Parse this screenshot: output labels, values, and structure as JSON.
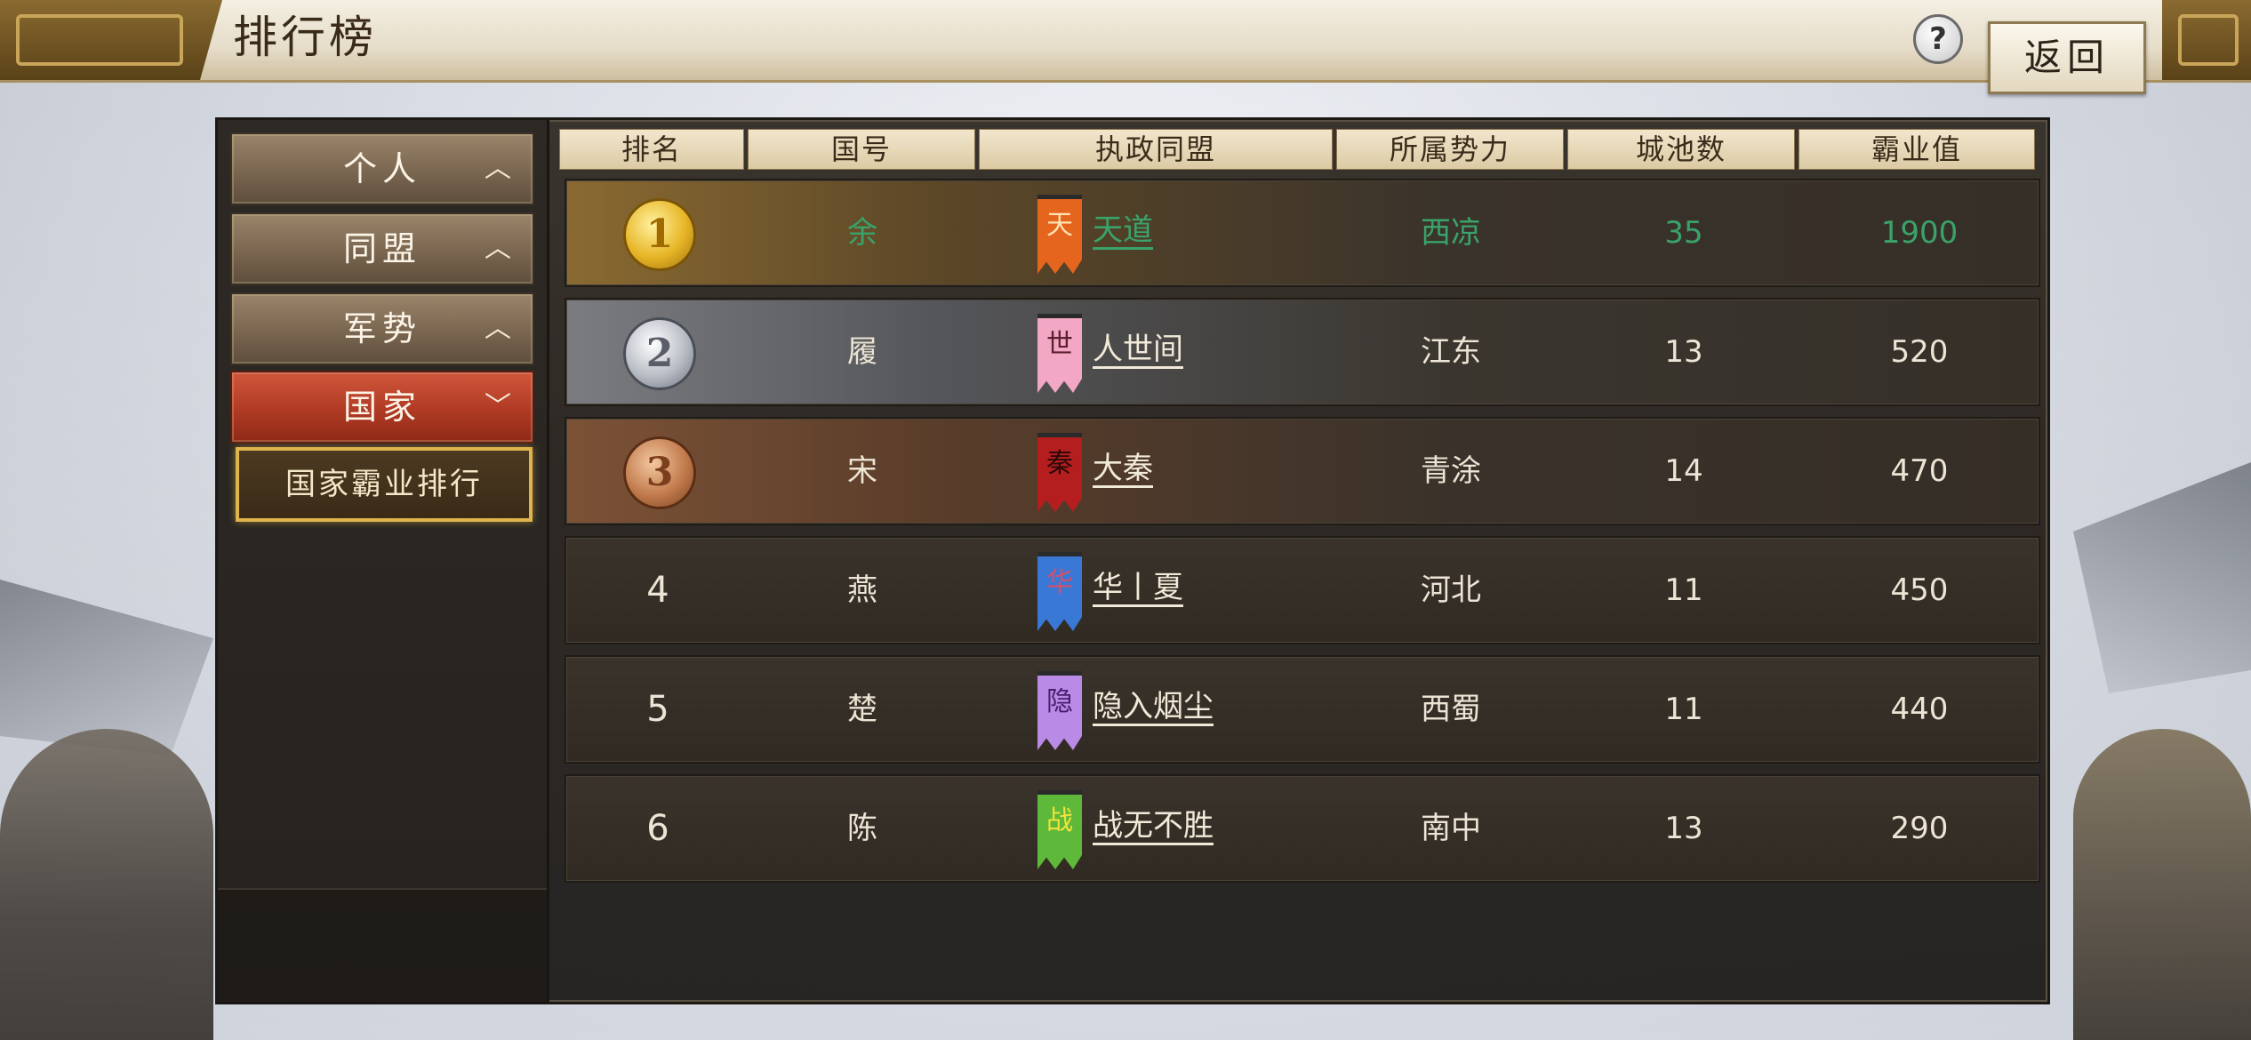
{
  "header": {
    "title": "排行榜",
    "help_label": "?",
    "back_label": "返回"
  },
  "sidebar": {
    "items": [
      {
        "label": "个人",
        "chevron": "︿"
      },
      {
        "label": "同盟",
        "chevron": "︿"
      },
      {
        "label": "军势",
        "chevron": "︿"
      },
      {
        "label": "国家",
        "chevron": "﹀"
      }
    ],
    "active_item": "国家",
    "sub_item": "国家霸业排行"
  },
  "table": {
    "columns": [
      "排名",
      "国号",
      "执政同盟",
      "所属势力",
      "城池数",
      "霸业值"
    ],
    "rows": [
      {
        "rank": "1",
        "nation": "余",
        "alliance": "天道",
        "banner_char": "天",
        "banner_color": "#e6651e",
        "faction": "西凉",
        "cities": "35",
        "score": "1900"
      },
      {
        "rank": "2",
        "nation": "履",
        "alliance": "人世间",
        "banner_char": "世",
        "banner_color": "#f2a7c4",
        "faction": "江东",
        "cities": "13",
        "score": "520"
      },
      {
        "rank": "3",
        "nation": "宋",
        "alliance": "大秦",
        "banner_char": "秦",
        "banner_color": "#b41e1e",
        "faction": "青涂",
        "cities": "14",
        "score": "470"
      },
      {
        "rank": "4",
        "nation": "燕",
        "alliance": "华丨夏",
        "banner_char": "华",
        "banner_color": "#3a78d6",
        "faction": "河北",
        "cities": "11",
        "score": "450"
      },
      {
        "rank": "5",
        "nation": "楚",
        "alliance": "隐入烟尘",
        "banner_char": "隐",
        "banner_color": "#b98ae6",
        "faction": "西蜀",
        "cities": "11",
        "score": "440"
      },
      {
        "rank": "6",
        "nation": "陈",
        "alliance": "战无不胜",
        "banner_char": "战",
        "banner_color": "#5eb83a",
        "faction": "南中",
        "cities": "13",
        "score": "290"
      }
    ]
  },
  "colors": {
    "top_rank_text": "#3aa36a",
    "active_nav": "#c0432b",
    "sub_item_border": "#e0b44c"
  }
}
